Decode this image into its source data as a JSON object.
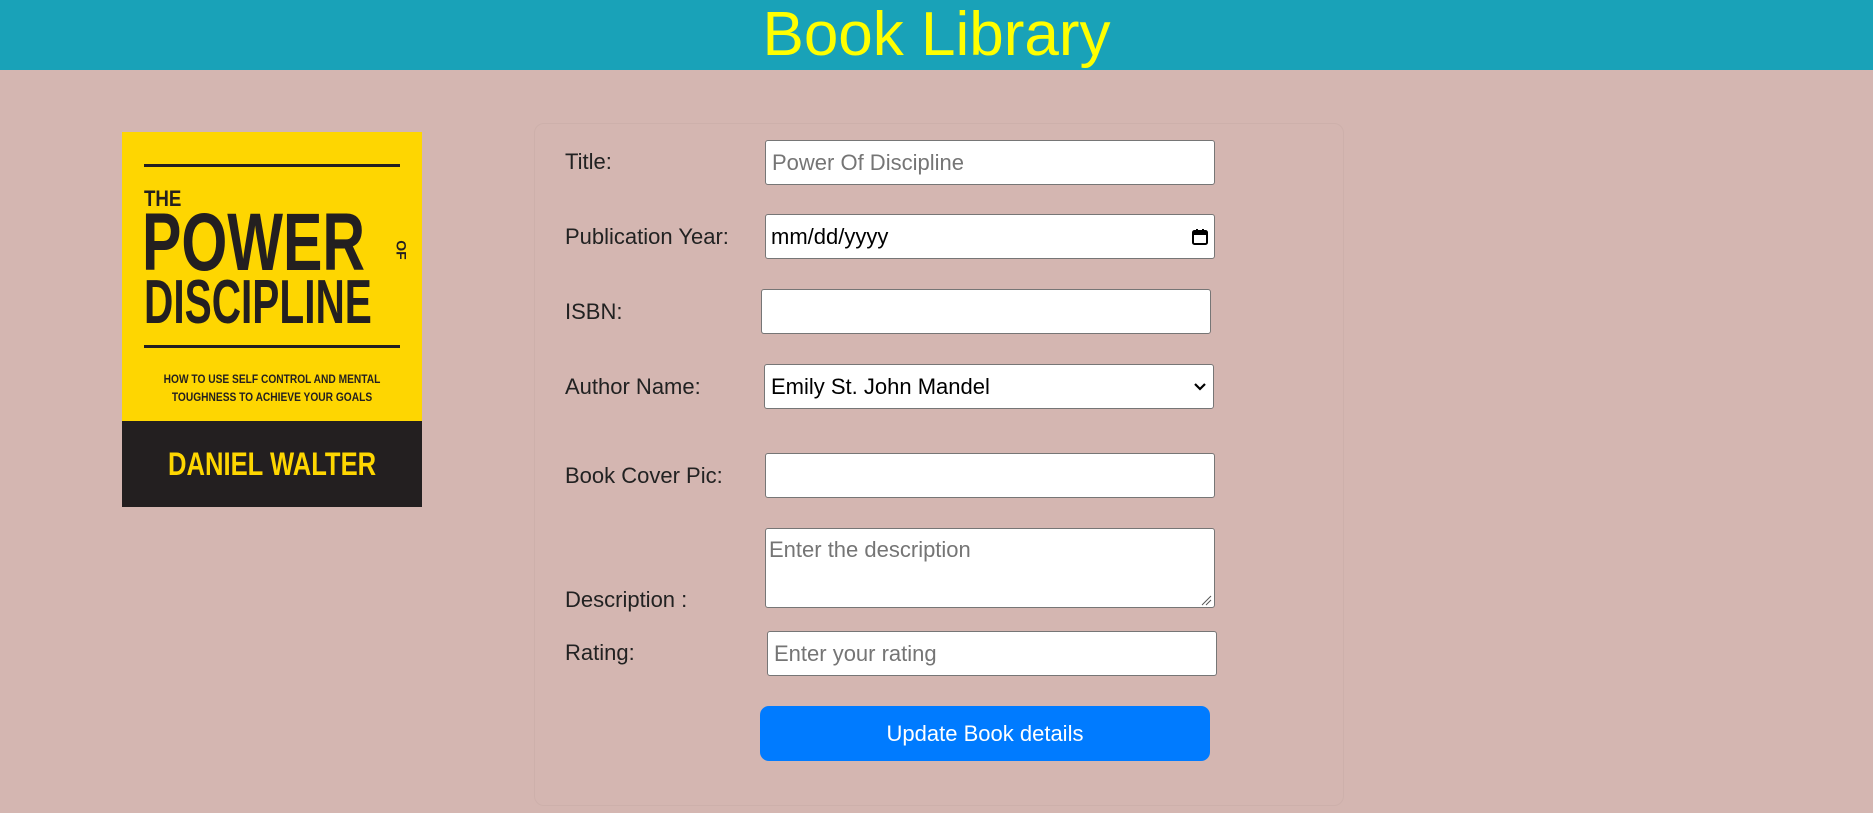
{
  "header": {
    "title": "Book Library"
  },
  "cover": {
    "the": "THE",
    "power": "POWER",
    "of": "OF",
    "discipline": "DISCIPLINE",
    "tagline_1": "HOW TO USE SELF CONTROL AND MENTAL",
    "tagline_2": "TOUGHNESS TO ACHIEVE YOUR GOALS",
    "author": "DANIEL WALTER"
  },
  "form": {
    "title_label": "Title:",
    "title_placeholder": "Power Of Discipline",
    "year_label": "Publication Year:",
    "year_value": "mm/dd/yyyy",
    "isbn_label": "ISBN:",
    "isbn_value": "",
    "author_label": "Author Name:",
    "author_selected": "Emily St. John Mandel",
    "cover_label": "Book Cover Pic:",
    "cover_value": "",
    "description_label": "Description :",
    "description_placeholder": "Enter the description",
    "rating_label": "Rating:",
    "rating_placeholder": "Enter your rating",
    "submit_label": "Update Book details"
  },
  "colors": {
    "header_bg": "#19a2b8",
    "title_color": "#ffff00",
    "page_bg": "#d4b6b1",
    "button_bg": "#007bff"
  },
  "icons": {
    "date": "calendar-icon",
    "select": "chevron-down-icon",
    "textarea": "resize-grip-icon"
  }
}
